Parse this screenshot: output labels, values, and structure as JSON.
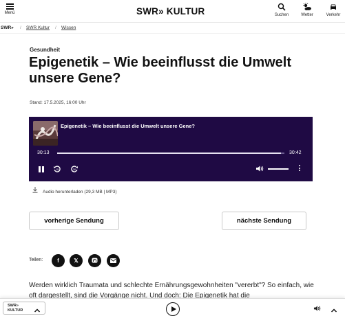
{
  "header": {
    "menu_label": "Menü",
    "logo": "SWR» KULTUR",
    "items": [
      {
        "label": "Suchen",
        "icon": "search-icon"
      },
      {
        "label": "Wetter",
        "icon": "weather-icon"
      },
      {
        "label": "Verkehr",
        "icon": "car-icon"
      }
    ]
  },
  "breadcrumb": {
    "home": "SWR»",
    "items": [
      "SWR Kultur",
      "Wissen"
    ]
  },
  "article": {
    "kicker": "Gesundheit",
    "title": "Epigenetik – Wie beeinflusst die Umwelt unsere Gene?",
    "stand": "Stand: 17.5.2025, 16:00 Uhr",
    "paragraph": "Werden wirklich Traumata und schlechte Ernährungsgewohnheiten \"vererbt\"? So einfach, wie oft dargestellt, sind die Vorgänge nicht. Und doch: Die Epigenetik hat die"
  },
  "player": {
    "title": "Epigenetik – Wie beeinflusst die Umwelt unsere Gene?",
    "current_time": "30:13",
    "total_time": "30:42",
    "progress": 0.984,
    "volume": 1.0,
    "bg_color": "#1f0a44"
  },
  "download": {
    "label": "Audio herunterladen (29,3 MB | MP3)"
  },
  "nav": {
    "prev": "vorherige Sendung",
    "next": "nächste Sendung"
  },
  "share": {
    "label": "Teilen:",
    "buttons": [
      "facebook-icon",
      "x-icon",
      "mastodon-icon",
      "mail-icon"
    ]
  },
  "bottombar": {
    "logo": "SWR» KULTUR"
  }
}
